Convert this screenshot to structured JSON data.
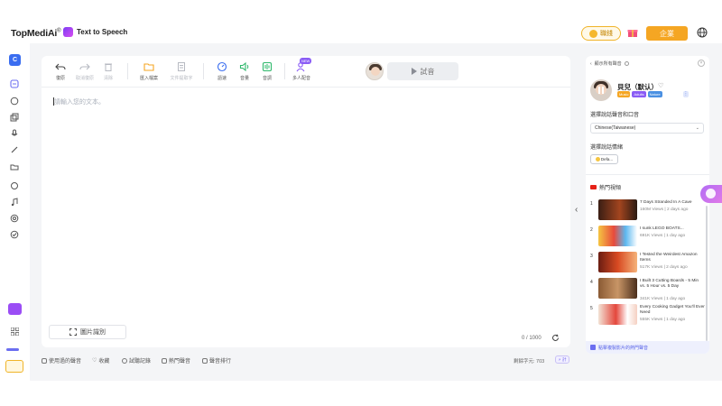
{
  "header": {
    "logo": "TopMediAi",
    "logo_mark": "®",
    "app_name": "Text to Speech",
    "coins_label": "職錢",
    "business_label": "企業"
  },
  "sidebar": {
    "top_badge": "C"
  },
  "toolbar": {
    "items": [
      {
        "label": "復原",
        "icon": "undo-icon",
        "enabled": true
      },
      {
        "label": "取消復原",
        "icon": "redo-icon",
        "enabled": false
      },
      {
        "label": "清除",
        "icon": "trash-icon",
        "enabled": false
      },
      {
        "label": "匯入檔案",
        "icon": "folder-icon",
        "enabled": true
      },
      {
        "label": "文件提取字",
        "icon": "doc-icon",
        "enabled": false
      },
      {
        "label": "語速",
        "icon": "speed-icon",
        "enabled": true
      },
      {
        "label": "音量",
        "icon": "volume-icon",
        "enabled": true
      },
      {
        "label": "音調",
        "icon": "pitch-icon",
        "enabled": true
      },
      {
        "label": "多人配音",
        "icon": "multi-speaker-icon",
        "enabled": true
      }
    ],
    "new_badge": "NEW",
    "play_label": "試音"
  },
  "editor": {
    "placeholder": "請輸入您的文本。",
    "ocr_label": "圖片識別",
    "char_count": "0 / 1000"
  },
  "bottom_links": [
    {
      "label": "使用過的聲音",
      "icon": "user-icon"
    },
    {
      "label": "收藏",
      "icon": "heart-icon"
    },
    {
      "label": "試聽記錄",
      "icon": "history-icon"
    },
    {
      "label": "熱門聲音",
      "icon": "thumb-icon"
    },
    {
      "label": "聲音排行",
      "icon": "chart-icon"
    }
  ],
  "status": {
    "chars_left": "剩餘字元: 703",
    "chars_badge": "⚡ 計"
  },
  "right_panel": {
    "header": "顯示所有聲音",
    "voice_name": "貝兒（默认）",
    "tags": [
      {
        "label": "Music",
        "color": "#f5a623"
      },
      {
        "label": "Adults",
        "color": "#8a5cf5"
      },
      {
        "label": "Nature",
        "color": "#4a90e2"
      }
    ],
    "tag_more": "⋮",
    "accent_label": "選擇說話聲音和口音",
    "language": "Chinese(Taiwanese)",
    "emotion_label": "選擇說話情緒",
    "emotion_chip": "Defa...",
    "hot_title": "熱門視頻",
    "videos": [
      {
        "num": "1",
        "title": "7 Days Stranded In A Cave",
        "meta": "160M Views | 2 days ago"
      },
      {
        "num": "2",
        "title": "I sunk LEGO BOATS...",
        "meta": "691K Views | 1 day ago"
      },
      {
        "num": "3",
        "title": "I Tested the Weirdest Amazon Items",
        "meta": "517K Views | 2 days ago"
      },
      {
        "num": "4",
        "title": "I Built 3 Cutting Boards - 5 Min vs. 5 Hour vs. 5 Day",
        "meta": "341K Views | 1 day ago"
      },
      {
        "num": "5",
        "title": "Every Cooking Gadget You'll Ever Need",
        "meta": "555K Views | 1 day ago"
      }
    ],
    "footer": "點擊複製影片的熱門聲音"
  }
}
